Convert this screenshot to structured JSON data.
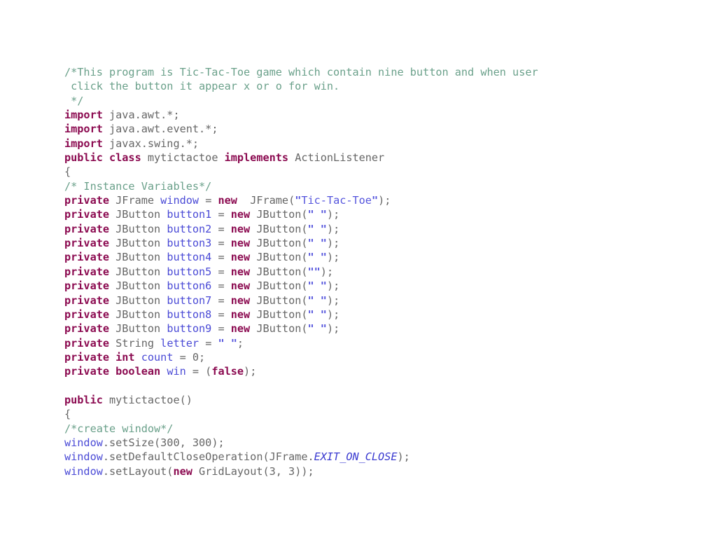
{
  "document": {
    "language": "java",
    "class_name": "mytictactoe",
    "theme": {
      "background": "#ffffff",
      "plain": "#666666",
      "comment": "#6aa08a",
      "keyword": "#8b0a50",
      "identifier": "#4a4ad6",
      "string": "#5555dd",
      "constant": "#3a3ad0"
    }
  },
  "code": {
    "lines": [
      {
        "id": "l1",
        "tokens": [
          {
            "t": "comment",
            "v": "/*This program is Tic-Tac-Toe game which contain nine button and when user"
          }
        ]
      },
      {
        "id": "l2",
        "tokens": [
          {
            "t": "comment",
            "v": " click the button it appear x or o for win."
          }
        ]
      },
      {
        "id": "l3",
        "tokens": [
          {
            "t": "comment",
            "v": " */"
          }
        ]
      },
      {
        "id": "l4",
        "tokens": [
          {
            "t": "keyword",
            "v": "import"
          },
          {
            "t": "plain",
            "v": " java.awt.*;"
          }
        ]
      },
      {
        "id": "l5",
        "tokens": [
          {
            "t": "keyword",
            "v": "import"
          },
          {
            "t": "plain",
            "v": " java.awt.event.*;"
          }
        ]
      },
      {
        "id": "l6",
        "tokens": [
          {
            "t": "keyword",
            "v": "import"
          },
          {
            "t": "plain",
            "v": " javax.swing.*;"
          }
        ]
      },
      {
        "id": "l7",
        "tokens": [
          {
            "t": "keyword",
            "v": "public class"
          },
          {
            "t": "plain",
            "v": " mytictactoe "
          },
          {
            "t": "keyword",
            "v": "implements"
          },
          {
            "t": "plain",
            "v": " ActionListener"
          }
        ]
      },
      {
        "id": "l8",
        "tokens": [
          {
            "t": "plain",
            "v": "{"
          }
        ]
      },
      {
        "id": "l9",
        "tokens": [
          {
            "t": "comment",
            "v": "/* Instance Variables*/"
          }
        ]
      },
      {
        "id": "l10",
        "tokens": [
          {
            "t": "keyword",
            "v": "private"
          },
          {
            "t": "plain",
            "v": " JFrame "
          },
          {
            "t": "ident",
            "v": "window"
          },
          {
            "t": "plain",
            "v": " = "
          },
          {
            "t": "keyword",
            "v": "new"
          },
          {
            "t": "plain",
            "v": "  JFrame("
          },
          {
            "t": "quote",
            "v": "\""
          },
          {
            "t": "string",
            "v": "Tic-Tac-Toe"
          },
          {
            "t": "quote",
            "v": "\""
          },
          {
            "t": "plain",
            "v": ");"
          }
        ]
      },
      {
        "id": "l11",
        "tokens": [
          {
            "t": "keyword",
            "v": "private"
          },
          {
            "t": "plain",
            "v": " JButton "
          },
          {
            "t": "ident",
            "v": "button1"
          },
          {
            "t": "plain",
            "v": " = "
          },
          {
            "t": "keyword",
            "v": "new"
          },
          {
            "t": "plain",
            "v": " JButton("
          },
          {
            "t": "quote",
            "v": "\" \""
          },
          {
            "t": "plain",
            "v": ");"
          }
        ]
      },
      {
        "id": "l12",
        "tokens": [
          {
            "t": "keyword",
            "v": "private"
          },
          {
            "t": "plain",
            "v": " JButton "
          },
          {
            "t": "ident",
            "v": "button2"
          },
          {
            "t": "plain",
            "v": " = "
          },
          {
            "t": "keyword",
            "v": "new"
          },
          {
            "t": "plain",
            "v": " JButton("
          },
          {
            "t": "quote",
            "v": "\" \""
          },
          {
            "t": "plain",
            "v": ");"
          }
        ]
      },
      {
        "id": "l13",
        "tokens": [
          {
            "t": "keyword",
            "v": "private"
          },
          {
            "t": "plain",
            "v": " JButton "
          },
          {
            "t": "ident",
            "v": "button3"
          },
          {
            "t": "plain",
            "v": " = "
          },
          {
            "t": "keyword",
            "v": "new"
          },
          {
            "t": "plain",
            "v": " JButton("
          },
          {
            "t": "quote",
            "v": "\" \""
          },
          {
            "t": "plain",
            "v": ");"
          }
        ]
      },
      {
        "id": "l14",
        "tokens": [
          {
            "t": "keyword",
            "v": "private"
          },
          {
            "t": "plain",
            "v": " JButton "
          },
          {
            "t": "ident",
            "v": "button4"
          },
          {
            "t": "plain",
            "v": " = "
          },
          {
            "t": "keyword",
            "v": "new"
          },
          {
            "t": "plain",
            "v": " JButton("
          },
          {
            "t": "quote",
            "v": "\" \""
          },
          {
            "t": "plain",
            "v": ");"
          }
        ]
      },
      {
        "id": "l15",
        "tokens": [
          {
            "t": "keyword",
            "v": "private"
          },
          {
            "t": "plain",
            "v": " JButton "
          },
          {
            "t": "ident",
            "v": "button5"
          },
          {
            "t": "plain",
            "v": " = "
          },
          {
            "t": "keyword",
            "v": "new"
          },
          {
            "t": "plain",
            "v": " JButton("
          },
          {
            "t": "quote",
            "v": "\"\""
          },
          {
            "t": "plain",
            "v": ");"
          }
        ]
      },
      {
        "id": "l16",
        "tokens": [
          {
            "t": "keyword",
            "v": "private"
          },
          {
            "t": "plain",
            "v": " JButton "
          },
          {
            "t": "ident",
            "v": "button6"
          },
          {
            "t": "plain",
            "v": " = "
          },
          {
            "t": "keyword",
            "v": "new"
          },
          {
            "t": "plain",
            "v": " JButton("
          },
          {
            "t": "quote",
            "v": "\" \""
          },
          {
            "t": "plain",
            "v": ");"
          }
        ]
      },
      {
        "id": "l17",
        "tokens": [
          {
            "t": "keyword",
            "v": "private"
          },
          {
            "t": "plain",
            "v": " JButton "
          },
          {
            "t": "ident",
            "v": "button7"
          },
          {
            "t": "plain",
            "v": " = "
          },
          {
            "t": "keyword",
            "v": "new"
          },
          {
            "t": "plain",
            "v": " JButton("
          },
          {
            "t": "quote",
            "v": "\" \""
          },
          {
            "t": "plain",
            "v": ");"
          }
        ]
      },
      {
        "id": "l18",
        "tokens": [
          {
            "t": "keyword",
            "v": "private"
          },
          {
            "t": "plain",
            "v": " JButton "
          },
          {
            "t": "ident",
            "v": "button8"
          },
          {
            "t": "plain",
            "v": " = "
          },
          {
            "t": "keyword",
            "v": "new"
          },
          {
            "t": "plain",
            "v": " JButton("
          },
          {
            "t": "quote",
            "v": "\" \""
          },
          {
            "t": "plain",
            "v": ");"
          }
        ]
      },
      {
        "id": "l19",
        "tokens": [
          {
            "t": "keyword",
            "v": "private"
          },
          {
            "t": "plain",
            "v": " JButton "
          },
          {
            "t": "ident",
            "v": "button9"
          },
          {
            "t": "plain",
            "v": " = "
          },
          {
            "t": "keyword",
            "v": "new"
          },
          {
            "t": "plain",
            "v": " JButton("
          },
          {
            "t": "quote",
            "v": "\" \""
          },
          {
            "t": "plain",
            "v": ");"
          }
        ]
      },
      {
        "id": "l20",
        "tokens": [
          {
            "t": "keyword",
            "v": "private"
          },
          {
            "t": "plain",
            "v": " String "
          },
          {
            "t": "ident",
            "v": "letter"
          },
          {
            "t": "plain",
            "v": " = "
          },
          {
            "t": "quote",
            "v": "\" \""
          },
          {
            "t": "plain",
            "v": ";"
          }
        ]
      },
      {
        "id": "l21",
        "tokens": [
          {
            "t": "keyword",
            "v": "private int"
          },
          {
            "t": "plain",
            "v": " "
          },
          {
            "t": "ident",
            "v": "count"
          },
          {
            "t": "plain",
            "v": " = 0;"
          }
        ]
      },
      {
        "id": "l22",
        "tokens": [
          {
            "t": "keyword",
            "v": "private boolean"
          },
          {
            "t": "plain",
            "v": " "
          },
          {
            "t": "ident",
            "v": "win"
          },
          {
            "t": "plain",
            "v": " = ("
          },
          {
            "t": "keyword",
            "v": "false"
          },
          {
            "t": "plain",
            "v": ");"
          }
        ]
      },
      {
        "id": "l23",
        "tokens": []
      },
      {
        "id": "l24",
        "tokens": [
          {
            "t": "keyword",
            "v": "public"
          },
          {
            "t": "plain",
            "v": " mytictactoe()"
          }
        ]
      },
      {
        "id": "l25",
        "tokens": [
          {
            "t": "plain",
            "v": "{"
          }
        ]
      },
      {
        "id": "l26",
        "tokens": [
          {
            "t": "comment",
            "v": "/*create window*/"
          }
        ]
      },
      {
        "id": "l27",
        "tokens": [
          {
            "t": "ident",
            "v": "window"
          },
          {
            "t": "plain",
            "v": ".setSize(300, 300);"
          }
        ]
      },
      {
        "id": "l28",
        "tokens": [
          {
            "t": "ident",
            "v": "window"
          },
          {
            "t": "plain",
            "v": ".setDefaultCloseOperation(JFrame."
          },
          {
            "t": "const",
            "v": "EXIT_ON_CLOSE"
          },
          {
            "t": "plain",
            "v": ");"
          }
        ]
      },
      {
        "id": "l29",
        "tokens": [
          {
            "t": "ident",
            "v": "window"
          },
          {
            "t": "plain",
            "v": ".setLayout("
          },
          {
            "t": "keyword",
            "v": "new"
          },
          {
            "t": "plain",
            "v": " GridLayout(3, 3));"
          }
        ]
      }
    ]
  }
}
